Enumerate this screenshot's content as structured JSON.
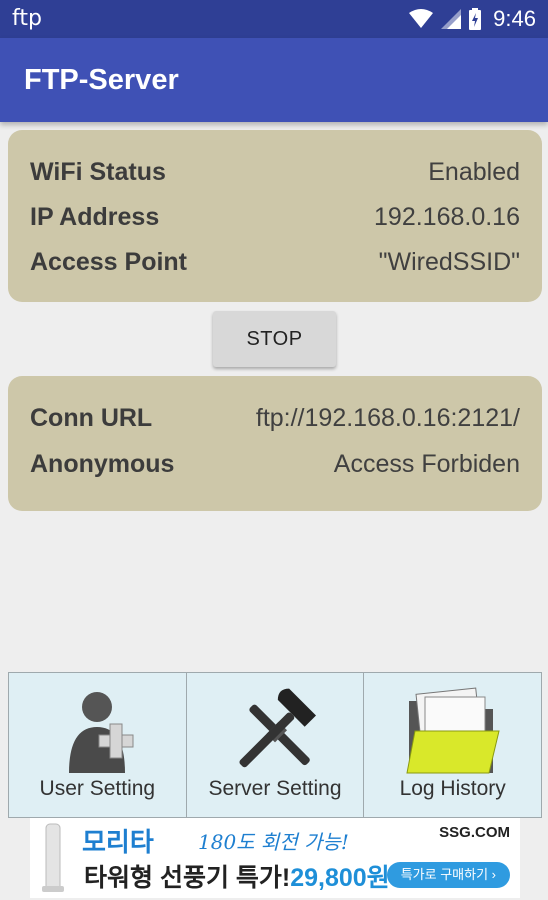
{
  "status_bar": {
    "app_tag": "ftp",
    "time": "9:46"
  },
  "app_bar": {
    "title": "FTP-Server"
  },
  "wifi_card": {
    "rows": [
      {
        "label": "WiFi Status",
        "value": "Enabled"
      },
      {
        "label": "IP Address",
        "value": "192.168.0.16"
      },
      {
        "label": "Access Point",
        "value": "\"WiredSSID\""
      }
    ]
  },
  "stop_button": {
    "label": "STOP"
  },
  "conn_card": {
    "rows": [
      {
        "label": "Conn URL",
        "value": "ftp://192.168.0.16:2121/"
      },
      {
        "label": "Anonymous",
        "value": "Access Forbiden"
      }
    ]
  },
  "tiles": [
    {
      "label": "User Setting",
      "icon": "add-user-icon"
    },
    {
      "label": "Server Setting",
      "icon": "tools-icon"
    },
    {
      "label": "Log History",
      "icon": "folder-icon"
    }
  ],
  "ad": {
    "brand": "모리타",
    "tagline": "180도 회전 가능!",
    "site": "SSG.COM",
    "headline": "타워형 선풍기 특가!",
    "price": "29,800원",
    "cta": "특가로 구매하기 ›"
  },
  "colors": {
    "primary": "#3f51b5",
    "status_bar": "#2f3f95",
    "card": "#cdc7a9",
    "tile": "#dfeff4"
  }
}
